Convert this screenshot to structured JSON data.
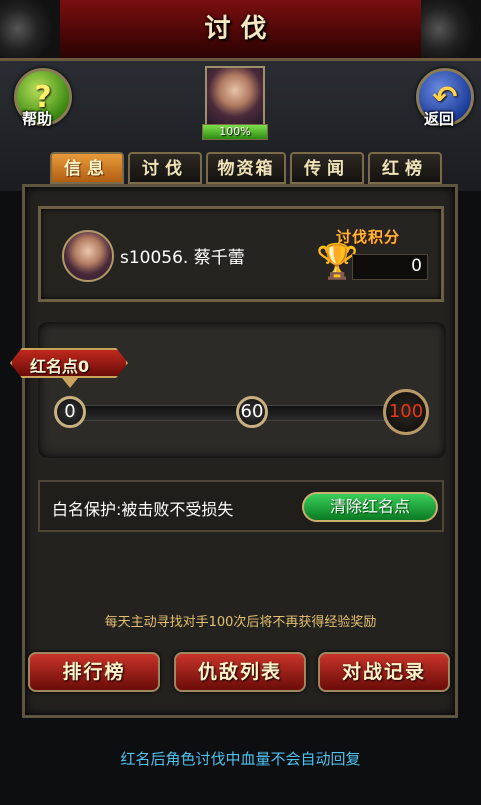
{
  "header": {
    "title": "讨伐"
  },
  "top": {
    "help_label": "帮助",
    "help_glyph": "?",
    "back_label": "返回",
    "back_glyph": "↶",
    "hp_percent": "100%",
    "hp_fraction": 1.0
  },
  "tabs": [
    {
      "label": "信息",
      "active": true
    },
    {
      "label": "讨伐",
      "active": false
    },
    {
      "label": "物资箱",
      "active": false
    },
    {
      "label": "传闻",
      "active": false
    },
    {
      "label": "红榜",
      "active": false
    }
  ],
  "player": {
    "name": "s10056. 蔡千蕾",
    "score_label": "讨伐积分",
    "score_value": "0",
    "trophy_icon": "trophy-icon"
  },
  "red_points": {
    "label": "红名点0",
    "current": 0,
    "ticks": [
      "0",
      "60",
      "100"
    ]
  },
  "protection": {
    "text": "白名保护:被击败不受损失",
    "clear_button": "清除红名点"
  },
  "hints": {
    "daily": "每天主动寻找对手100次后将不再获得经验奖励",
    "bottom": "红名后角色讨伐中血量不会自动回复"
  },
  "actions": {
    "ranking": "排行榜",
    "enemies": "仇敌列表",
    "records": "对战记录"
  },
  "colors": {
    "accent": "#e89a3a",
    "tip": "#4ec2f0",
    "danger": "#e8361a"
  }
}
